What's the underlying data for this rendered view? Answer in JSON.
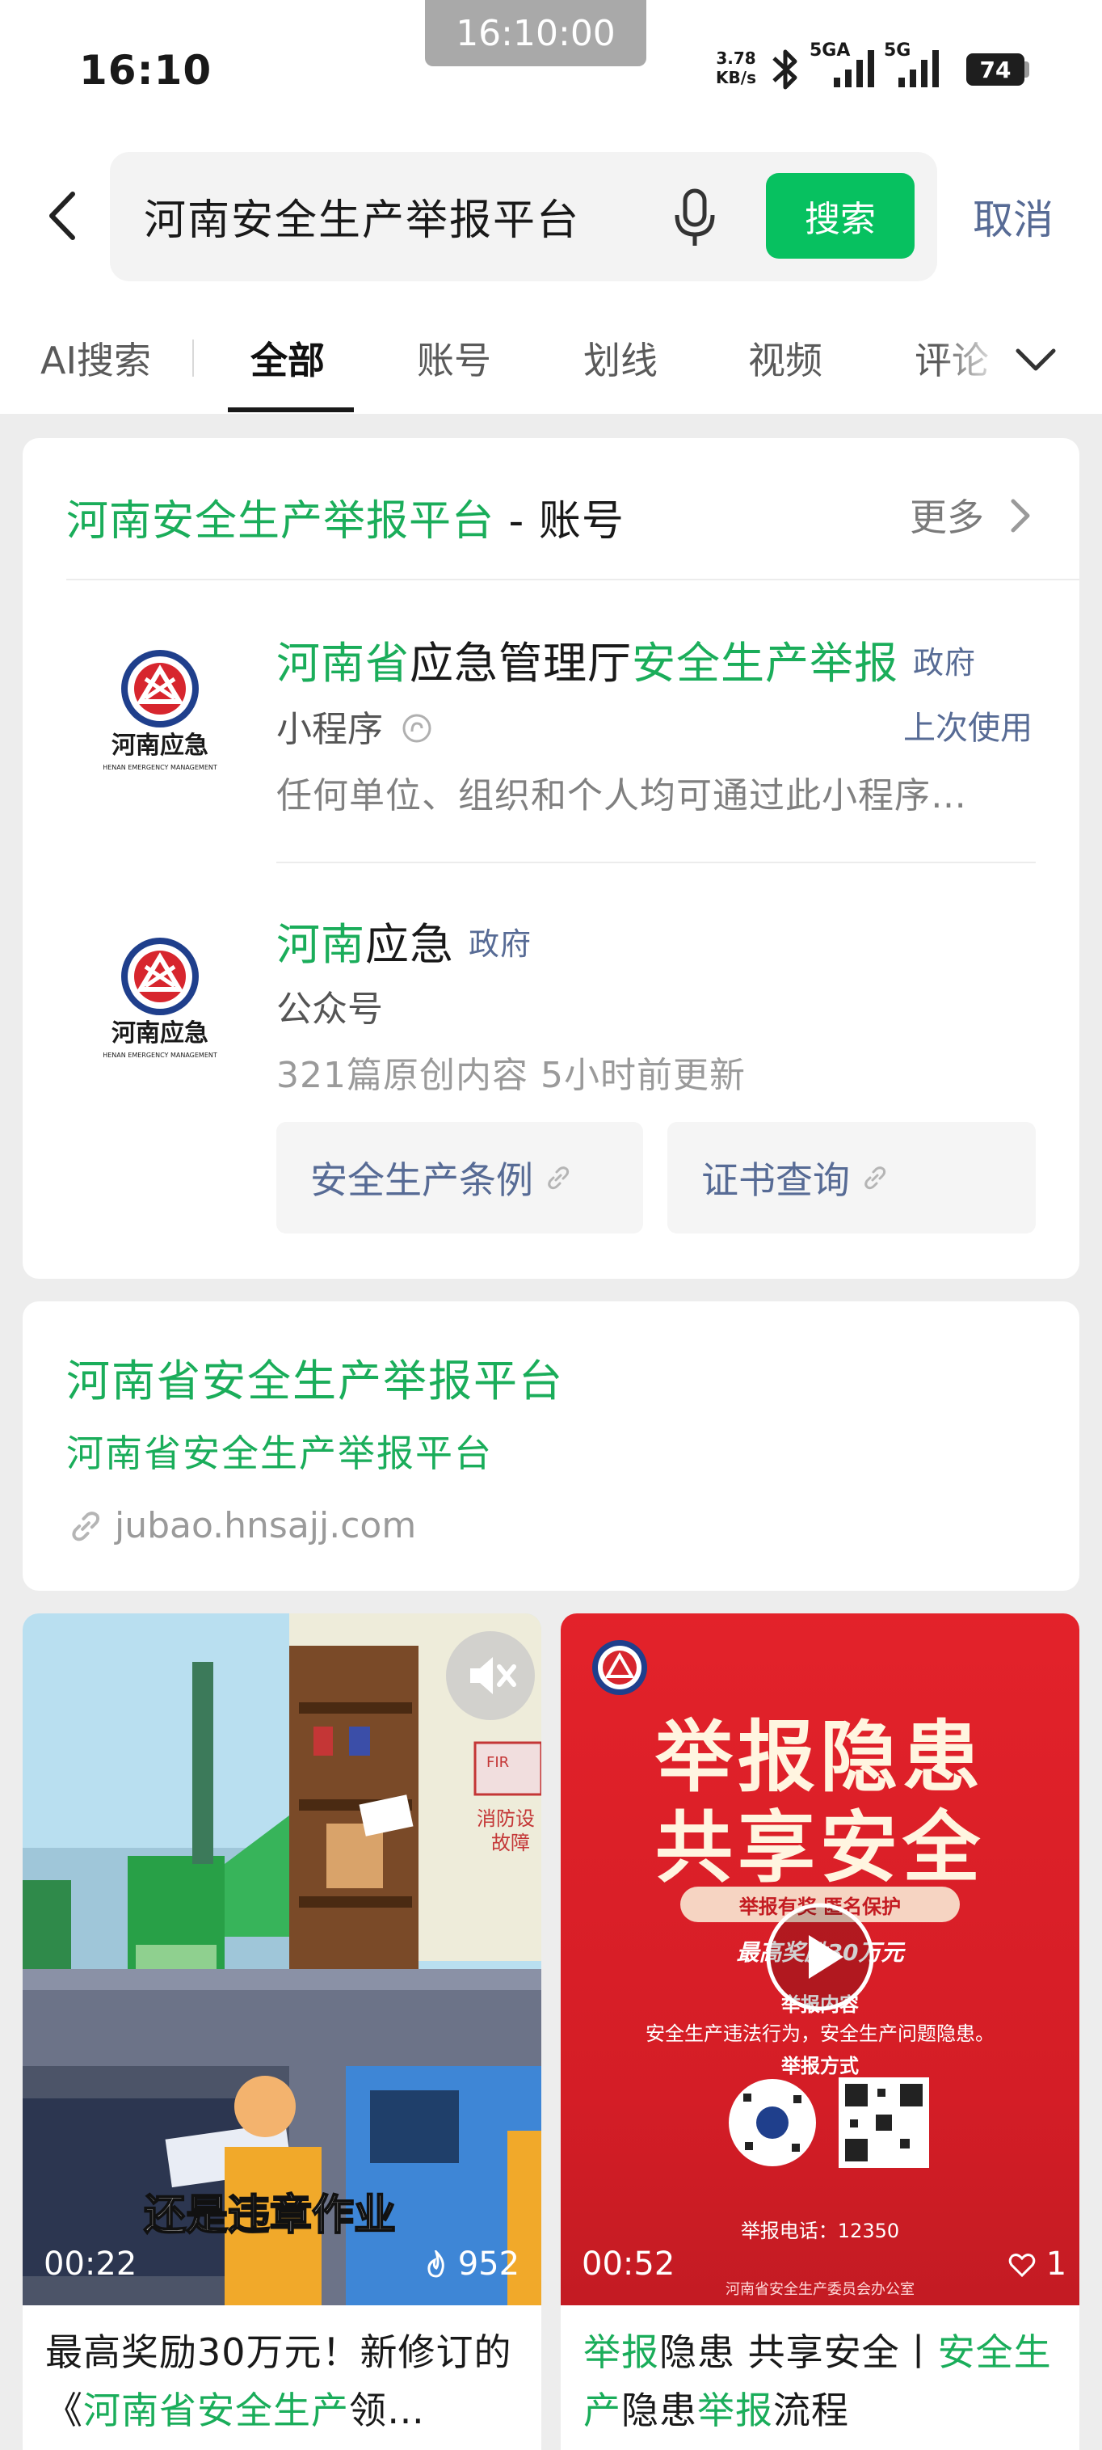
{
  "status_bar": {
    "time": "16:10",
    "time_badge": "16:10:00",
    "net_speed_value": "3.78",
    "net_speed_unit": "KB/s",
    "signal1_label": "5GA",
    "signal2_label": "5G",
    "battery": "74"
  },
  "search": {
    "query": "河南安全生产举报平台",
    "button_label": "搜索",
    "cancel_label": "取消"
  },
  "tabs": [
    {
      "label": "AI搜索"
    },
    {
      "label": "全部"
    },
    {
      "label": "账号"
    },
    {
      "label": "划线"
    },
    {
      "label": "视频"
    },
    {
      "label": "评论"
    }
  ],
  "account_section": {
    "title_highlight": "河南安全生产举报平台",
    "title_suffix": " - 账号",
    "more_label": "更多",
    "items": [
      {
        "name_parts": [
          "河南省",
          "应急管理厅",
          "安全生产举报"
        ],
        "badge": "政府",
        "type": "小程序",
        "last_used": "上次使用",
        "desc": "任何单位、组织和个人均可通过此小程序…",
        "logo_label": "河南应急",
        "logo_en": "HENAN EMERGENCY MANAGEMENT"
      },
      {
        "name_parts": [
          "河南",
          "应急"
        ],
        "badge": "政府",
        "type": "公众号",
        "stats": "321篇原创内容  5小时前更新",
        "logo_label": "河南应急",
        "logo_en": "HENAN EMERGENCY MANAGEMENT",
        "links": [
          "安全生产条例",
          "证书查询"
        ]
      }
    ]
  },
  "web_result": {
    "title": "河南省安全生产举报平台",
    "subtitle": "河南省安全生产举报平台",
    "url": "jubao.hnsajj.com"
  },
  "videos": [
    {
      "duration": "00:22",
      "likes": "952",
      "overlay_text": "还是违章作业",
      "sign_text": "消防设",
      "sign_text2": "故障",
      "caption_parts": [
        "最高奖励30万元！新修订的《",
        "河南省安全生产",
        "领…"
      ]
    },
    {
      "duration": "00:52",
      "likes": "1",
      "poster_line1": "举报隐患",
      "poster_line2": "共享安全",
      "poster_tag": "举报有奖  匿名保护",
      "poster_reward": "最高奖励30万元",
      "poster_content_h": "举报内容",
      "poster_content": "安全生产违法行为，安全生产问题隐患。",
      "poster_method_h": "举报方式",
      "poster_phone": "举报电话：12350",
      "poster_footer": "河南省安全生产委员会办公室",
      "caption_parts": [
        "举报",
        "隐患 共享安全丨",
        "安全生产",
        "隐患",
        "举报",
        "流程"
      ]
    }
  ]
}
